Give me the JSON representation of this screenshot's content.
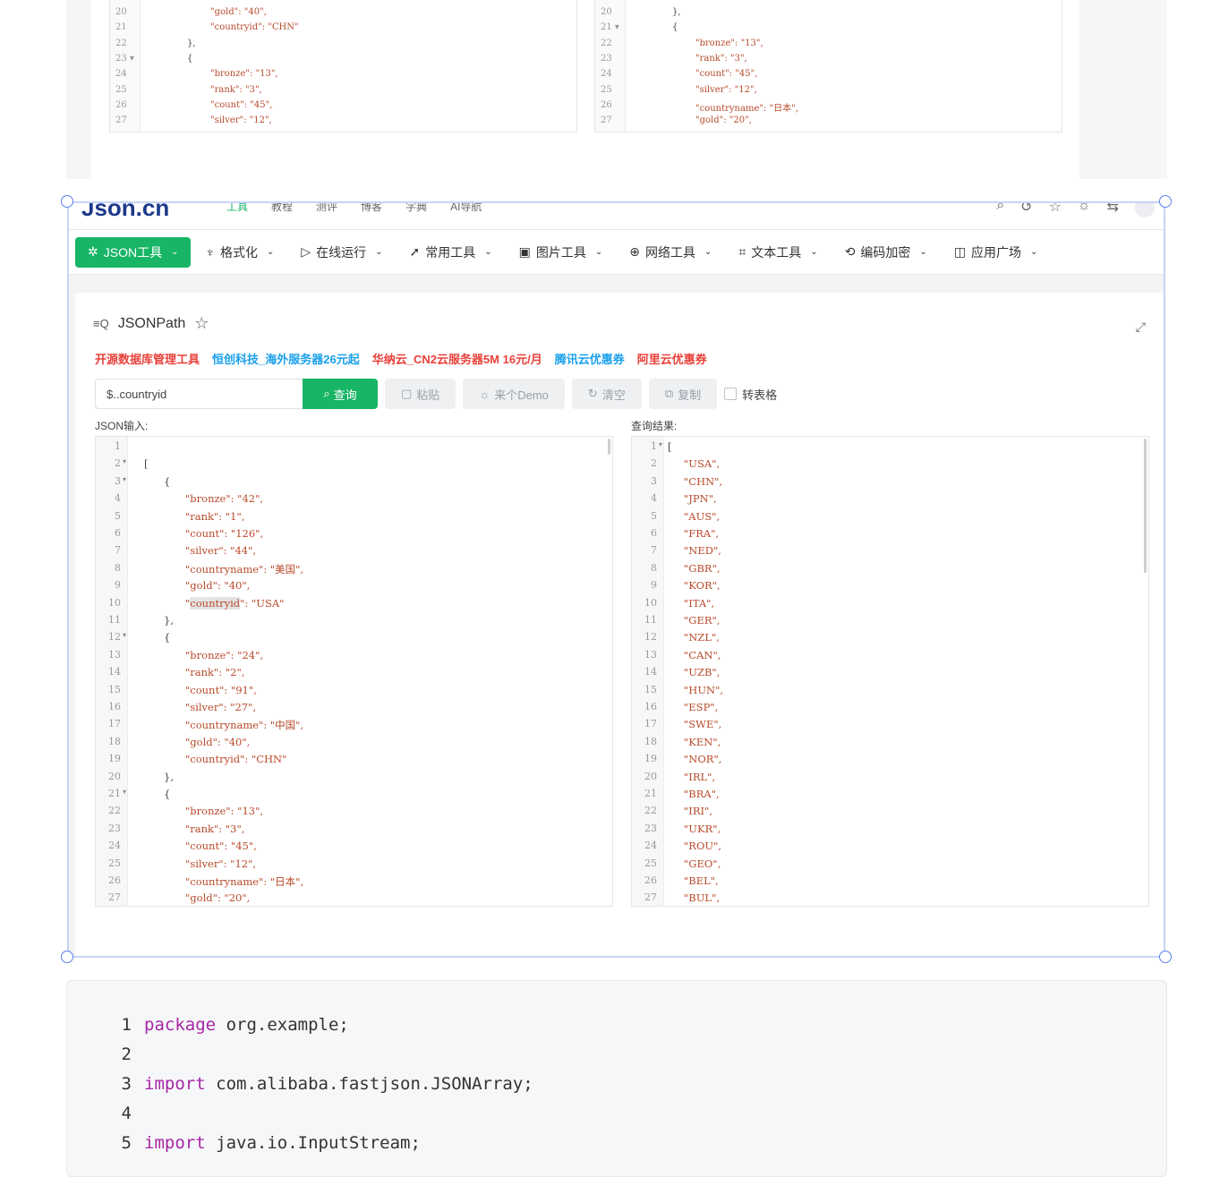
{
  "top_shot": {
    "left_lines": [
      {
        "n": "20",
        "text": "\"gold\": \"40\","
      },
      {
        "n": "21",
        "text": "\"countryid\": \"CHN\""
      },
      {
        "n": "22",
        "text": "},"
      },
      {
        "n": "23 ▾",
        "text": "{"
      },
      {
        "n": "24",
        "text": "\"bronze\": \"13\","
      },
      {
        "n": "25",
        "text": "\"rank\": \"3\","
      },
      {
        "n": "26",
        "text": "\"count\": \"45\","
      },
      {
        "n": "27",
        "text": "\"silver\": \"12\","
      }
    ],
    "right_lines": [
      {
        "n": "20",
        "text": "},"
      },
      {
        "n": "21 ▾",
        "text": "{"
      },
      {
        "n": "22",
        "text": "\"bronze\": \"13\","
      },
      {
        "n": "23",
        "text": "\"rank\": \"3\","
      },
      {
        "n": "24",
        "text": "\"count\": \"45\","
      },
      {
        "n": "25",
        "text": "\"silver\": \"12\","
      },
      {
        "n": "26",
        "text": "\"countryname\": \"日本\","
      },
      {
        "n": "27",
        "text": "\"gold\": \"20\","
      }
    ]
  },
  "site": {
    "logo": "Json.cn",
    "top_nav": [
      "工具",
      "教程",
      "测评",
      "博客",
      "字典",
      "AI导航"
    ]
  },
  "menu": [
    {
      "label": "JSON工具",
      "icon": "sparkle-icon",
      "active": true
    },
    {
      "label": "格式化",
      "icon": "brush-icon"
    },
    {
      "label": "在线运行",
      "icon": "play-icon"
    },
    {
      "label": "常用工具",
      "icon": "rocket-icon"
    },
    {
      "label": "图片工具",
      "icon": "image-icon"
    },
    {
      "label": "网络工具",
      "icon": "globe-icon"
    },
    {
      "label": "文本工具",
      "icon": "text-icon"
    },
    {
      "label": "编码加密",
      "icon": "refresh-lock-icon"
    },
    {
      "label": "应用广场",
      "icon": "app-icon"
    }
  ],
  "page": {
    "title": "JSONPath",
    "ads": [
      {
        "text": "开源数据库管理工具",
        "color": "#e8413a"
      },
      {
        "text": "恒创科技_海外服务器26元起",
        "color": "#1aa0ec"
      },
      {
        "text": "华纳云_CN2云服务器5M 16元/月",
        "color": "#e8413a"
      },
      {
        "text": "腾讯云优惠券",
        "color": "#1aa0ec"
      },
      {
        "text": "阿里云优惠券",
        "color": "#e8413a"
      }
    ],
    "query_value": "$..countryid",
    "query_btn": "查询",
    "paste_btn": "粘贴",
    "demo_btn": "来个Demo",
    "clear_btn": "清空",
    "copy_btn": "复制",
    "table_toggle": "转表格",
    "input_label": "JSON输入:",
    "result_label": "查询结果:"
  },
  "input_lines": [
    {
      "n": "1",
      "fold": "",
      "indent": 0,
      "text": ""
    },
    {
      "n": "2",
      "fold": "▾",
      "indent": 0,
      "text": "["
    },
    {
      "n": "3",
      "fold": "▾",
      "indent": 1,
      "text": "{"
    },
    {
      "n": "4",
      "fold": "",
      "indent": 2,
      "text": "\"bronze\": \"42\","
    },
    {
      "n": "5",
      "fold": "",
      "indent": 2,
      "text": "\"rank\": \"1\","
    },
    {
      "n": "6",
      "fold": "",
      "indent": 2,
      "text": "\"count\": \"126\","
    },
    {
      "n": "7",
      "fold": "",
      "indent": 2,
      "text": "\"silver\": \"44\","
    },
    {
      "n": "8",
      "fold": "",
      "indent": 2,
      "text": "\"countryname\": \"美国\","
    },
    {
      "n": "9",
      "fold": "",
      "indent": 2,
      "text": "\"gold\": \"40\","
    },
    {
      "n": "10",
      "fold": "",
      "indent": 2,
      "text": "\"countryid\": \"USA\""
    },
    {
      "n": "11",
      "fold": "",
      "indent": 1,
      "text": "},"
    },
    {
      "n": "12",
      "fold": "▾",
      "indent": 1,
      "text": "{"
    },
    {
      "n": "13",
      "fold": "",
      "indent": 2,
      "text": "\"bronze\": \"24\","
    },
    {
      "n": "14",
      "fold": "",
      "indent": 2,
      "text": "\"rank\": \"2\","
    },
    {
      "n": "15",
      "fold": "",
      "indent": 2,
      "text": "\"count\": \"91\","
    },
    {
      "n": "16",
      "fold": "",
      "indent": 2,
      "text": "\"silver\": \"27\","
    },
    {
      "n": "17",
      "fold": "",
      "indent": 2,
      "text": "\"countryname\": \"中国\","
    },
    {
      "n": "18",
      "fold": "",
      "indent": 2,
      "text": "\"gold\": \"40\","
    },
    {
      "n": "19",
      "fold": "",
      "indent": 2,
      "text": "\"countryid\": \"CHN\""
    },
    {
      "n": "20",
      "fold": "",
      "indent": 1,
      "text": "},"
    },
    {
      "n": "21",
      "fold": "▾",
      "indent": 1,
      "text": "{"
    },
    {
      "n": "22",
      "fold": "",
      "indent": 2,
      "text": "\"bronze\": \"13\","
    },
    {
      "n": "23",
      "fold": "",
      "indent": 2,
      "text": "\"rank\": \"3\","
    },
    {
      "n": "24",
      "fold": "",
      "indent": 2,
      "text": "\"count\": \"45\","
    },
    {
      "n": "25",
      "fold": "",
      "indent": 2,
      "text": "\"silver\": \"12\","
    },
    {
      "n": "26",
      "fold": "",
      "indent": 2,
      "text": "\"countryname\": \"日本\","
    },
    {
      "n": "27",
      "fold": "",
      "indent": 2,
      "text": "\"gold\": \"20\","
    }
  ],
  "result_lines": [
    {
      "n": "1",
      "fold": "▾",
      "text": "["
    },
    {
      "n": "2",
      "text": "\"USA\","
    },
    {
      "n": "3",
      "text": "\"CHN\","
    },
    {
      "n": "4",
      "text": "\"JPN\","
    },
    {
      "n": "5",
      "text": "\"AUS\","
    },
    {
      "n": "6",
      "text": "\"FRA\","
    },
    {
      "n": "7",
      "text": "\"NED\","
    },
    {
      "n": "8",
      "text": "\"GBR\","
    },
    {
      "n": "9",
      "text": "\"KOR\","
    },
    {
      "n": "10",
      "text": "\"ITA\","
    },
    {
      "n": "11",
      "text": "\"GER\","
    },
    {
      "n": "12",
      "text": "\"NZL\","
    },
    {
      "n": "13",
      "text": "\"CAN\","
    },
    {
      "n": "14",
      "text": "\"UZB\","
    },
    {
      "n": "15",
      "text": "\"HUN\","
    },
    {
      "n": "16",
      "text": "\"ESP\","
    },
    {
      "n": "17",
      "text": "\"SWE\","
    },
    {
      "n": "18",
      "text": "\"KEN\","
    },
    {
      "n": "19",
      "text": "\"NOR\","
    },
    {
      "n": "20",
      "text": "\"IRL\","
    },
    {
      "n": "21",
      "text": "\"BRA\","
    },
    {
      "n": "22",
      "text": "\"IRI\","
    },
    {
      "n": "23",
      "text": "\"UKR\","
    },
    {
      "n": "24",
      "text": "\"ROU\","
    },
    {
      "n": "25",
      "text": "\"GEO\","
    },
    {
      "n": "26",
      "text": "\"BEL\","
    },
    {
      "n": "27",
      "text": "\"BUL\","
    }
  ],
  "code": [
    {
      "n": "1",
      "kw": "package",
      "rest": " org.example;"
    },
    {
      "n": "2",
      "kw": "",
      "rest": ""
    },
    {
      "n": "3",
      "kw": "import",
      "rest": " com.alibaba.fastjson.JSONArray;"
    },
    {
      "n": "4",
      "kw": "",
      "rest": ""
    },
    {
      "n": "5",
      "kw": "import",
      "rest": " java.io.InputStream;"
    }
  ],
  "colors": {
    "brand_green": "#18b566",
    "selection_handle": "#5b7fe6"
  }
}
